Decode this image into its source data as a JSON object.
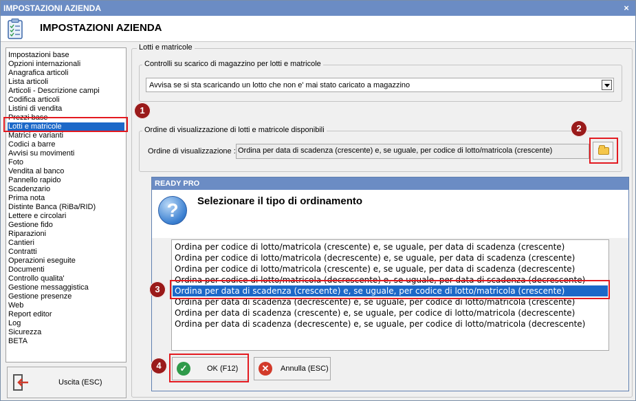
{
  "window": {
    "title": "IMPOSTAZIONI AZIENDA",
    "close_glyph": "×",
    "header_title": "IMPOSTAZIONI AZIENDA",
    "header_icon": "clipboard-checklist-icon"
  },
  "sidebar": {
    "items": [
      {
        "label": "Impostazioni base"
      },
      {
        "label": "Opzioni internazionali"
      },
      {
        "label": "Anagrafica articoli"
      },
      {
        "label": "Lista articoli"
      },
      {
        "label": "Articoli - Descrizione campi"
      },
      {
        "label": "Codifica articoli"
      },
      {
        "label": "Listini di vendita"
      },
      {
        "label": "Prezzi base"
      },
      {
        "label": "Lotti e matricole",
        "selected": true
      },
      {
        "label": "Matrici e varianti"
      },
      {
        "label": "Codici a barre"
      },
      {
        "label": "Avvisi su movimenti"
      },
      {
        "label": "Foto"
      },
      {
        "label": "Vendita al banco"
      },
      {
        "label": "Pannello rapido"
      },
      {
        "label": "Scadenzario"
      },
      {
        "label": "Prima nota"
      },
      {
        "label": "Distinte Banca (RiBa/RID)"
      },
      {
        "label": "Lettere e circolari"
      },
      {
        "label": "Gestione fido"
      },
      {
        "label": "Riparazioni"
      },
      {
        "label": "Cantieri"
      },
      {
        "label": "Contratti"
      },
      {
        "label": "Operazioni eseguite"
      },
      {
        "label": "Documenti"
      },
      {
        "label": "Controllo qualita'"
      },
      {
        "label": "Gestione messaggistica"
      },
      {
        "label": "Gestione presenze"
      },
      {
        "label": "Web"
      },
      {
        "label": "Report editor"
      },
      {
        "label": "Log"
      },
      {
        "label": "Sicurezza"
      },
      {
        "label": "BETA"
      }
    ],
    "exit_label": "Uscita (ESC)",
    "exit_icon": "exit-door-icon"
  },
  "main": {
    "section_title": "Lotti e matricole",
    "group1_title": "Controlli su scarico di magazzino per lotti e matricole",
    "combo_value": "Avvisa se si sta scaricando un lotto che non e' mai stato caricato a magazzino",
    "group2_title": "Ordine di visualizzazione di lotti e matricole disponibili",
    "order_label": "Ordine di visualizzazione :",
    "order_value": "Ordina per data di scadenza (crescente) e, se uguale, per codice di lotto/matricola (crescente)",
    "folder_icon": "folder-icon"
  },
  "callouts": [
    "1",
    "2",
    "3",
    "4"
  ],
  "dialog": {
    "title": "READY PRO",
    "message": "Selezionare il tipo di ordinamento",
    "question_glyph": "?",
    "options": [
      {
        "label": "Ordina per codice di lotto/matricola (crescente) e, se uguale, per data di scadenza (crescente)"
      },
      {
        "label": "Ordina per codice di lotto/matricola (decrescente) e, se uguale, per data di scadenza (crescente)"
      },
      {
        "label": "Ordina per codice di lotto/matricola (crescente) e, se uguale, per data di scadenza (decrescente)"
      },
      {
        "label": "Ordina per codice di lotto/matricola (decrescente) e, se uguale, per data di scadenza (decrescente)"
      },
      {
        "label": "Ordina per data di scadenza (crescente) e, se uguale, per codice di lotto/matricola (crescente)",
        "selected": true
      },
      {
        "label": "Ordina per data di scadenza (decrescente) e, se uguale, per codice di lotto/matricola (crescente)"
      },
      {
        "label": "Ordina per data di scadenza (crescente) e, se uguale, per codice di lotto/matricola (decrescente)"
      },
      {
        "label": "Ordina per data di scadenza (decrescente) e, se uguale, per codice di lotto/matricola (decrescente)"
      }
    ],
    "ok_label": "OK (F12)",
    "ok_glyph": "✓",
    "cancel_label": "Annulla (ESC)",
    "cancel_glyph": "✕"
  },
  "colors": {
    "titlebar": "#6b8cc4",
    "selection": "#1c68c8",
    "highlight_box": "#e3191f",
    "callout": "#9a1a1a",
    "ok_icon": "#2f9a4a",
    "cancel_icon": "#d23a2a"
  }
}
